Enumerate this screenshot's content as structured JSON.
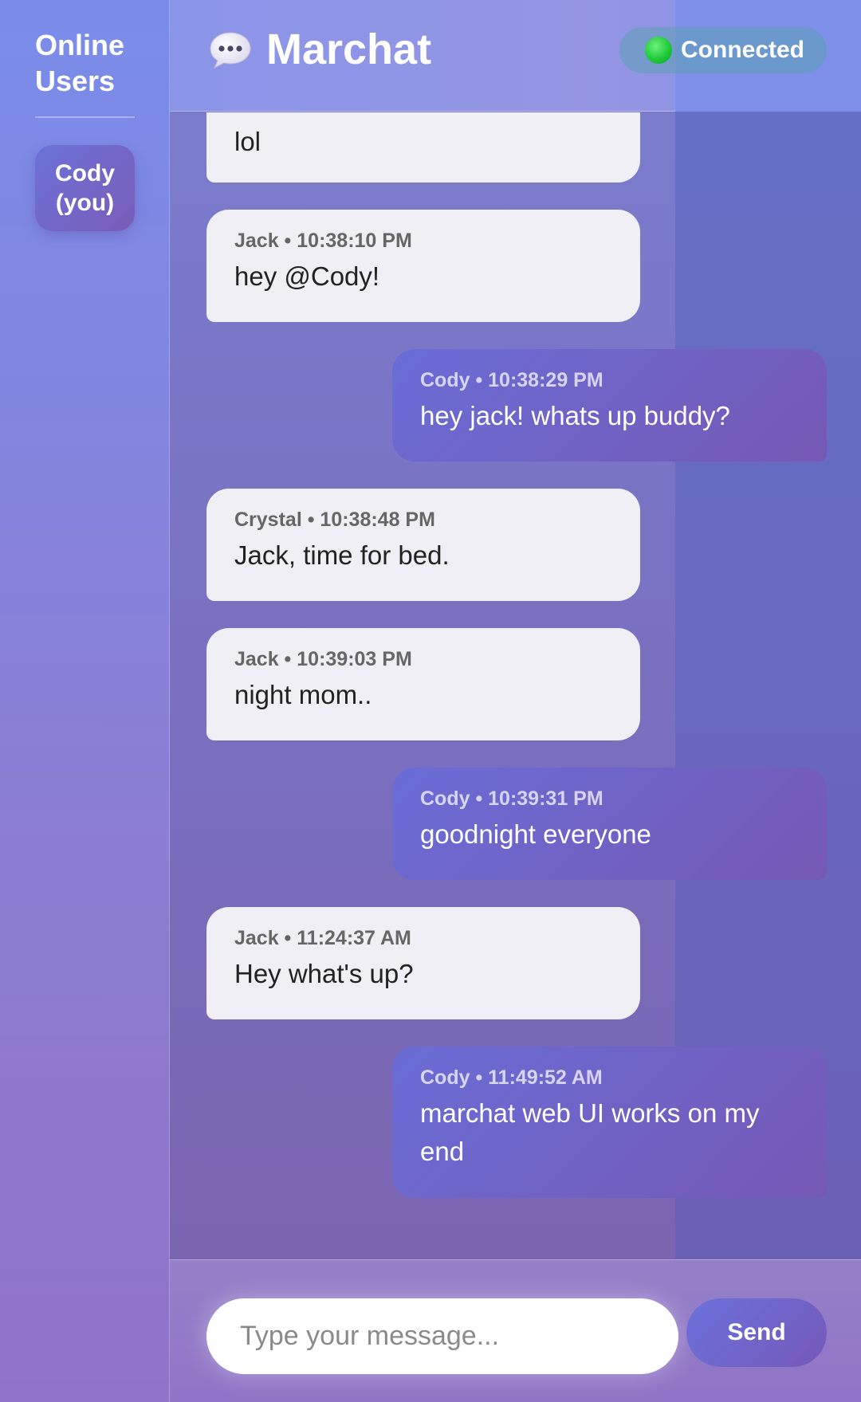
{
  "sidebar": {
    "title": "Online Users",
    "users": [
      {
        "label": "Cody (you)"
      }
    ]
  },
  "header": {
    "app_title": "Marchat",
    "chat_icon": "speech-bubble-icon",
    "status": "Connected",
    "status_color": "#1fcb3a"
  },
  "messages": [
    {
      "direction": "in",
      "meta": "",
      "text": "lol"
    },
    {
      "direction": "in",
      "meta": "Jack • 10:38:10 PM",
      "text": "hey @Cody!"
    },
    {
      "direction": "out",
      "meta": "Cody • 10:38:29 PM",
      "text": "hey jack! whats up buddy?"
    },
    {
      "direction": "in",
      "meta": "Crystal • 10:38:48 PM",
      "text": "Jack, time for bed."
    },
    {
      "direction": "in",
      "meta": "Jack • 10:39:03 PM",
      "text": "night mom.."
    },
    {
      "direction": "out",
      "meta": "Cody • 10:39:31 PM",
      "text": "goodnight everyone"
    },
    {
      "direction": "in",
      "meta": "Jack • 11:24:37 AM",
      "text": "Hey what's up?"
    },
    {
      "direction": "out",
      "meta": "Cody • 11:49:52 AM",
      "text": "marchat web UI works on my end"
    }
  ],
  "composer": {
    "placeholder": "Type your message...",
    "value": "",
    "send_label": "Send"
  },
  "colors": {
    "accent": "#6a6dd6",
    "accent_alt": "#7658b4",
    "incoming_bubble": "#efeff5"
  }
}
